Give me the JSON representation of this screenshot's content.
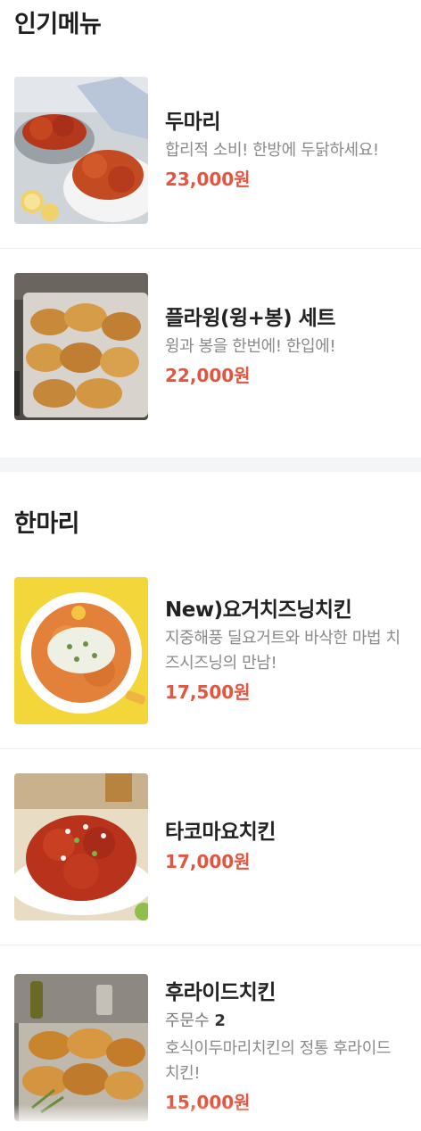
{
  "sections": [
    {
      "title": "인기메뉴",
      "items": [
        {
          "name": "두마리",
          "desc": "합리적 소비! 한방에 두닭하세요!",
          "price": "23,000원",
          "image_icon": "fried-chicken-platter-icon"
        },
        {
          "name": "플라윙(윙+봉) 세트",
          "desc": "윙과 봉을 한번에! 한입에!",
          "price": "22,000원",
          "image_icon": "chicken-wings-icon"
        }
      ]
    },
    {
      "title": "한마리",
      "items": [
        {
          "name": "New)요거치즈닝치킨",
          "desc": "지중해풍 딜요거트와 바삭한 마법 치즈시즈닝의 만남!",
          "price": "17,500원",
          "image_icon": "yogurt-chicken-icon"
        },
        {
          "name": "타코마요치킨",
          "price": "17,000원",
          "image_icon": "taco-mayo-chicken-icon"
        },
        {
          "name": "후라이드치킨",
          "orders_label": "주문수",
          "orders_count": "2",
          "desc": "호식이두마리치킨의 정통 후라이드 치킨!",
          "price": "15,000원",
          "image_icon": "fried-chicken-icon"
        }
      ]
    }
  ],
  "colors": {
    "price": "#e4553f",
    "section_gap": "#f4f5f7"
  }
}
